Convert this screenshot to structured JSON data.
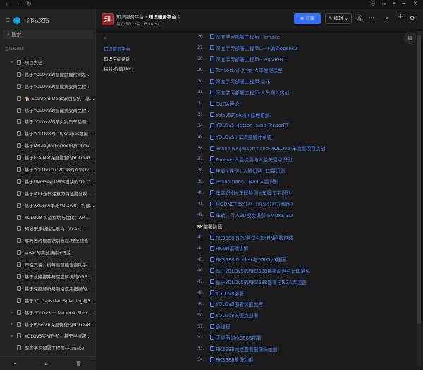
{
  "titlebar": {
    "back": "‹",
    "forward": "›",
    "reload": "↻"
  },
  "sidebar": {
    "app_name": "飞书云文档",
    "search_placeholder": "搜索",
    "section_label": "直接知识库",
    "items": [
      {
        "label": "项目大全",
        "expandable": true
      },
      {
        "label": "基于YOLOv8的智能肿瘤检测系...",
        "expandable": false
      },
      {
        "label": "基于YOLOv8的智能货架商品检...",
        "expandable": false
      },
      {
        "label": "🐕 Stanford Dogs识别系统：基...",
        "expandable": false
      },
      {
        "label": "基于YOLOv8的智能货架商品检...",
        "expandable": false
      },
      {
        "label": "基于YOLOv8的单类别汽车检测...",
        "expandable": false
      },
      {
        "label": "基于YOLOv8的Cityscapes数据集...",
        "expandable": false
      },
      {
        "label": "基于MB-TaylorFormer的YOLOv8...",
        "expandable": false
      },
      {
        "label": "基于FFA-Net深度融合的YOLOv8...",
        "expandable": false
      },
      {
        "label": "基于YOLOv10 C2fCIB的YOLOv8...",
        "expandable": false
      },
      {
        "label": "基于DWRSeg DWR模块的YOLO...",
        "expandable": false
      },
      {
        "label": "基于iAFF迭代注意力特征融合模...",
        "expandable": false
      },
      {
        "label": "基于AKConv革新YOLOv8：构建...",
        "expandable": false
      },
      {
        "label": "YOLOv8 实战探坑与优化：AP ...",
        "expandable": false
      },
      {
        "label": "揭秘聚焦线性注意力（FLA）：...",
        "expandable": false
      },
      {
        "label": "解码器的语音识别教程-理论结合",
        "expandable": false
      },
      {
        "label": "Vosk 的实战演练+理论",
        "expandable": false
      },
      {
        "label": "声临其境：树莓派智能语音助手...",
        "expandable": false
      },
      {
        "label": "基于故障排除与深度解析的ORB...",
        "expandable": false
      },
      {
        "label": "基于深度解析与前沿应用拓展的...",
        "expandable": false
      },
      {
        "label": "基于3D Gaussian Splatting与3D...",
        "expandable": false
      },
      {
        "label": "基于YOLOv3 + Network Slimmi...",
        "expandable": true
      },
      {
        "label": "基于PyTorch深度优化的YOLOv8...",
        "expandable": true
      },
      {
        "label": "YOLOv5实战升阶：基于半监督...",
        "expandable": true
      },
      {
        "label": "深度学习部署工程师---cmake",
        "expandable": false
      },
      {
        "label": "深度学习部署工程师C++编译opencv",
        "expandable": false
      }
    ]
  },
  "header": {
    "logo_char": "知",
    "breadcrumb_parent": "知识服务平台",
    "breadcrumb_current": "知识服务平台",
    "last_modified": "最近修改: 1月7日 14:57",
    "share_label": "分享",
    "edit_label": "编辑"
  },
  "toc": {
    "items": [
      "知识服务平台",
      "知识空间帮助",
      "福利-价值1k¥:"
    ],
    "active_index": 0
  },
  "content": {
    "rows": [
      {
        "num": "26.",
        "text": "深度学习部署工程师---cmake"
      },
      {
        "num": "27.",
        "text": "深度学习部署工程师C++编译opencv"
      },
      {
        "num": "28.",
        "text": "深度学习部署工程师--TensorRT"
      },
      {
        "num": "29.",
        "text": "Tensort入门小案 人体检测模型"
      },
      {
        "num": "30.",
        "text": "深度学习部署工程师-量化"
      },
      {
        "num": "31.",
        "text": "深度学习部署工程师-人员闯入实战"
      },
      {
        "num": "32.",
        "text": "CUDA理论"
      },
      {
        "num": "33.",
        "text": "Yolov5的plugin原理讲解"
      },
      {
        "num": "34.",
        "text": "YOLOv5--Jetson nano-TensorRT"
      },
      {
        "num": "35.",
        "text": "YOLOv5+车流量统计系统"
      },
      {
        "num": "36.",
        "text": "jetson NX/Jetson nano--YOLOv5-车流量项目实战"
      },
      {
        "num": "37.",
        "text": "Facenet人脸检测与人脸关键点识别"
      },
      {
        "num": "38.",
        "text": "年龄+性别+人脸识别+口罩识别"
      },
      {
        "num": "39.",
        "text": "Jetson nano、NX+人脸识别"
      },
      {
        "num": "40.",
        "text": "车体识别+车牌检测+车牌文字识别"
      },
      {
        "num": "41.",
        "text": "MODNET-软分割（语义分割升级版）"
      },
      {
        "num": "42.",
        "text": "车辆、行人3D视觉识别-SMOKE 3D"
      },
      {
        "heading": "RK部署阶段"
      },
      {
        "num": "43.",
        "text": "RK3588 NPU测试与RKNN函数包装"
      },
      {
        "num": "44.",
        "text": "RKNN基础讲解"
      },
      {
        "num": "45.",
        "text": "RK3588 Docker与YOLOv5推理"
      },
      {
        "num": "46.",
        "text": "基于YOLOv5的RK3588部署原理与int8量化"
      },
      {
        "num": "47.",
        "text": "基于YOLOv5的RK3588部署与RGA库加速"
      },
      {
        "num": "48.",
        "text": "YOLOv8部署"
      },
      {
        "num": "49.",
        "text": "YOLOv8部署深度思考"
      },
      {
        "num": "50.",
        "text": "YOLOv8关键点部署"
      },
      {
        "num": "51.",
        "text": "多线程"
      },
      {
        "num": "52.",
        "text": "无桌面的rk3566部署"
      },
      {
        "num": "53.",
        "text": "RK3588网络查看摄像头画面"
      },
      {
        "num": "54.",
        "text": "RK3588录像功能"
      }
    ]
  },
  "colors": {
    "accent": "#3370ff",
    "link": "#4f84f5",
    "background": "#1b1b1b",
    "sidebar": "#232323"
  }
}
